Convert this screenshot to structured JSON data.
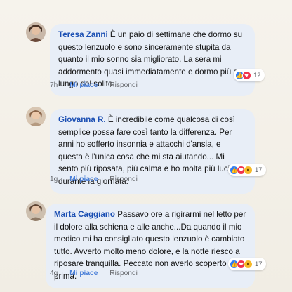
{
  "comments": [
    {
      "author": "Teresa Zanni",
      "text": " È un paio di settimane che dormo su questo lenzuolo e sono sinceramente stupita da quanto il mio sonno sia migliorato. La sera mi addormento quasi immediatamente e dormo più a lungo del solito.",
      "time": "7h",
      "like_label": "Mi piace",
      "reply_label": "Rispondi",
      "reactions": [
        "thumb",
        "heart"
      ],
      "reaction_count": "12",
      "avatar_color": "#7a5a4a"
    },
    {
      "author": "Giovanna R.",
      "text": " È incredibile come qualcosa di così semplice possa fare così tanto la differenza. Per anni ho sofferto insonnia e attacchi d'ansia, e questa è l'unica cosa che mi sta aiutando... Mi sento più riposata, più calma e ho molta più lucidità durante la giornata.",
      "time": "1g",
      "like_label": "Mi piace",
      "reply_label": "Rispondi",
      "reactions": [
        "thumb",
        "heart",
        "wow"
      ],
      "reaction_count": "17",
      "avatar_color": "#a07a5c"
    },
    {
      "author": "Marta Caggiano",
      "text": " Passavo ore a rigirarmi nel letto per il dolore alla schiena e alle anche...Da quando il mio medico mi ha consigliato questo lenzuolo è cambiato tutto. Avverto molto meno dolore, e la notte riesco a riposare tranquilla. Peccato non averlo scoperto prima.",
      "time": "4g",
      "like_label": "Mi piace",
      "reply_label": "Rispondi",
      "reactions": [
        "thumb",
        "heart",
        "wow"
      ],
      "reaction_count": "17",
      "avatar_color": "#8c6b52"
    }
  ]
}
